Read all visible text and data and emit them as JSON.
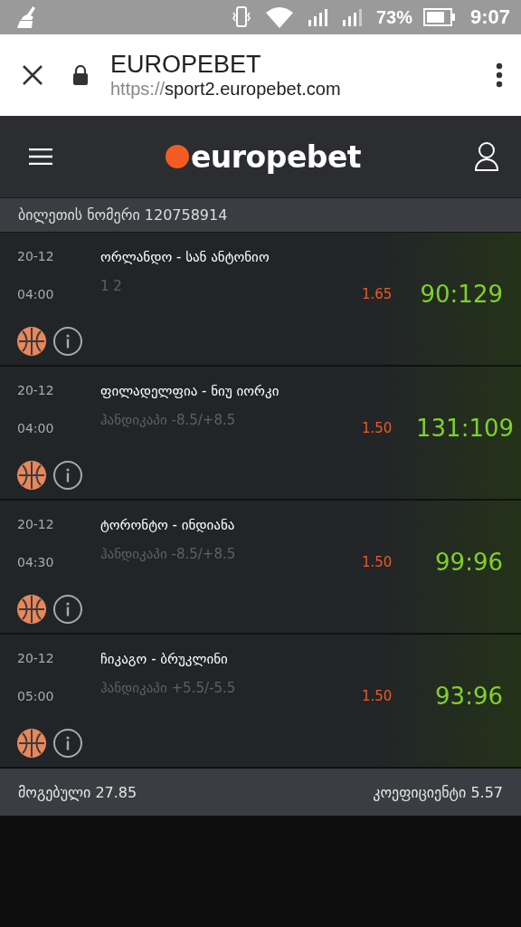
{
  "status_bar": {
    "battery": "73%",
    "time": "9:07"
  },
  "browser": {
    "title": "EUROPEBET",
    "url_scheme": "https://",
    "url_host": "sport2.europebet.com"
  },
  "header": {
    "logo": "europebet"
  },
  "ticket": {
    "label": "ბილეთის ნომერი 120758914"
  },
  "matches": [
    {
      "date": "20-12",
      "time": "04:00",
      "teams": "ორლანდო - სან ანტონიო",
      "market": "1 2",
      "odds": "1.65",
      "score": "90:129"
    },
    {
      "date": "20-12",
      "time": "04:00",
      "teams": "ფილადელფია - ნიუ იორკი",
      "market": "ჰანდიკაპი -8.5/+8.5",
      "odds": "1.50",
      "score": "131:109"
    },
    {
      "date": "20-12",
      "time": "04:30",
      "teams": "ტორონტო - ინდიანა",
      "market": "ჰანდიკაპი -8.5/+8.5",
      "odds": "1.50",
      "score": "99:96"
    },
    {
      "date": "20-12",
      "time": "05:00",
      "teams": "ჩიკაგო - ბრუკლინი",
      "market": "ჰანდიკაპი +5.5/-5.5",
      "odds": "1.50",
      "score": "93:96"
    }
  ],
  "footer": {
    "winnings": "მოგებული 27.85",
    "coefficient": "კოეფიციენტი 5.57"
  }
}
